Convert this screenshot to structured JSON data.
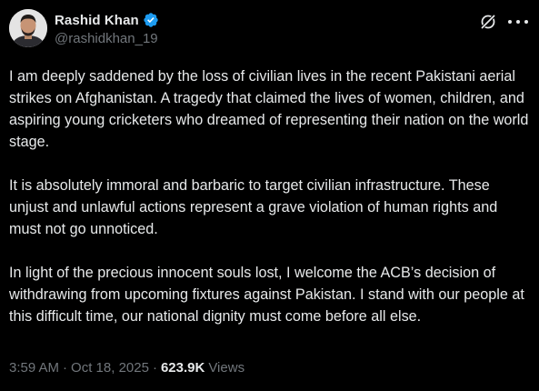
{
  "author": {
    "display_name": "Rashid Khan",
    "handle": "@rashidkhan_19",
    "verified": true,
    "verified_color": "#1d9bf0"
  },
  "header_icons": [
    "grok-icon",
    "more-options-icon"
  ],
  "tweet": {
    "paragraphs": [
      "I am deeply saddened by the loss of civilian lives in the recent Pakistani aerial strikes on Afghanistan. A tragedy that claimed the lives of women, children, and aspiring young cricketers who dreamed of representing their nation on the world stage.",
      "It is absolutely immoral and barbaric to target civilian infrastructure. These unjust and unlawful actions represent a grave violation of human rights and must not go unnoticed.",
      "In light of the precious innocent souls lost, I welcome the ACB’s decision of withdrawing from upcoming fixtures against Pakistan. I stand with our people at this difficult time, our national dignity must come before all else."
    ]
  },
  "meta": {
    "time": "3:59 AM",
    "separator_1": "·",
    "date": "Oct 18, 2025",
    "separator_2": "·",
    "views_count": "623.9K",
    "views_label": "Views"
  },
  "colors": {
    "background": "#000000",
    "text_primary": "#e7e9ea",
    "text_secondary": "#71767b"
  }
}
